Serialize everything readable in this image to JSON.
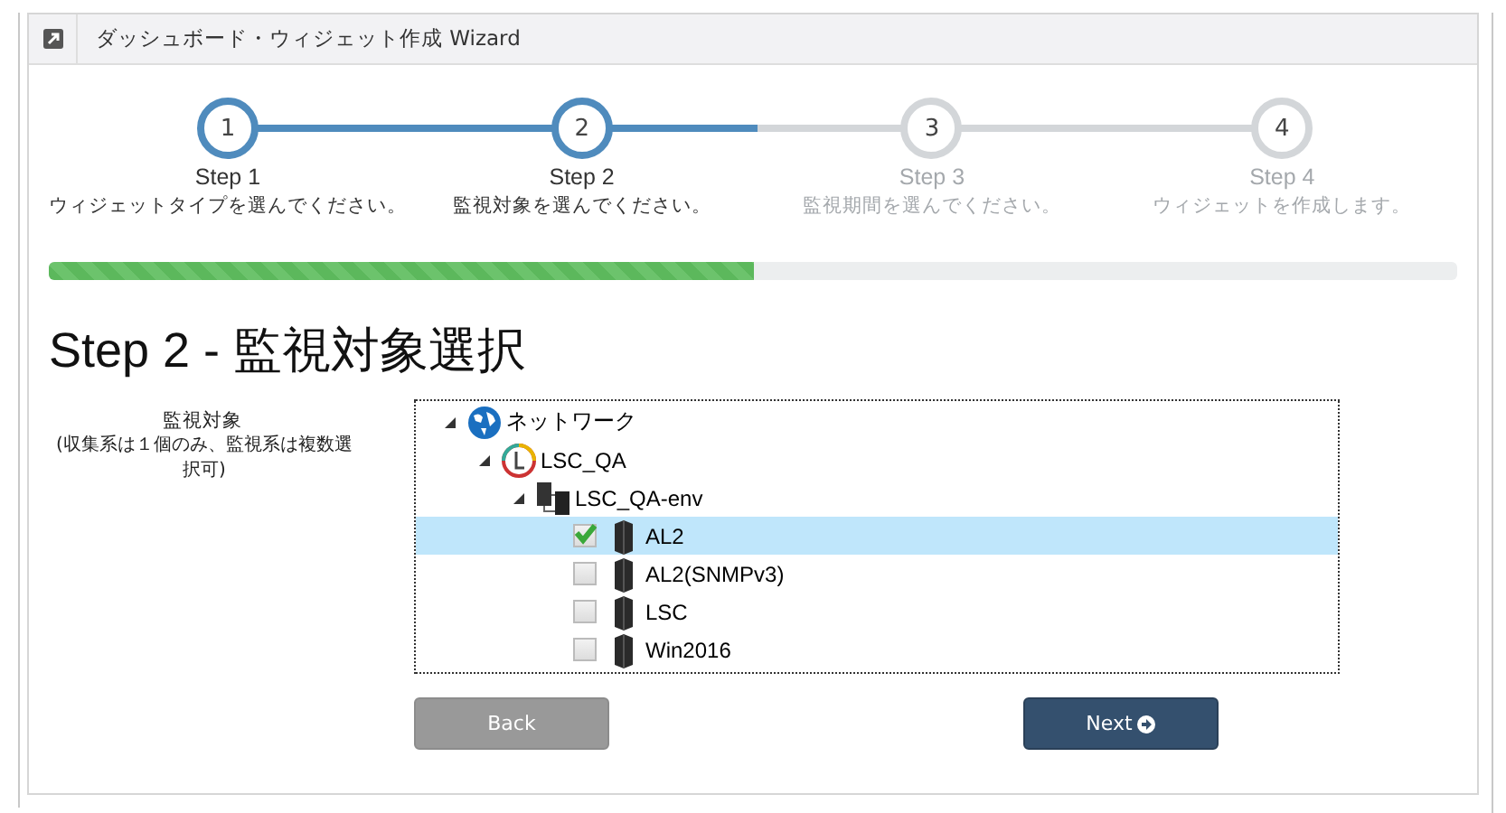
{
  "window": {
    "title": "ダッシュボード・ウィジェット作成 Wizard"
  },
  "steps": [
    {
      "number": "1",
      "label": "Step 1",
      "description": "ウィジェットタイプを選んでください。",
      "active": true
    },
    {
      "number": "2",
      "label": "Step 2",
      "description": "監視対象を選んでください。",
      "active": true
    },
    {
      "number": "3",
      "label": "Step 3",
      "description": "監視期間を選んでください。",
      "active": false
    },
    {
      "number": "4",
      "label": "Step 4",
      "description": "ウィジェットを作成します。",
      "active": false
    }
  ],
  "progress": {
    "level": 0.5
  },
  "heading": "Step 2 - 監視対象選択",
  "field_label": {
    "title": "監視対象",
    "note": "(収集系は１個のみ、監視系は複数選択可)"
  },
  "tree": [
    {
      "label": "ネットワーク",
      "kind": "network",
      "expanded": true,
      "children": [
        {
          "label": "LSC_QA",
          "kind": "group",
          "expanded": true,
          "children": [
            {
              "label": "LSC_QA-env",
              "kind": "env",
              "expanded": true,
              "children": [
                {
                  "label": "AL2",
                  "kind": "server",
                  "checked": true,
                  "selected": true
                },
                {
                  "label": "AL2(SNMPv3)",
                  "kind": "server",
                  "checked": false,
                  "selected": false
                },
                {
                  "label": "LSC",
                  "kind": "server",
                  "checked": false,
                  "selected": false
                },
                {
                  "label": "Win2016",
                  "kind": "server",
                  "checked": false,
                  "selected": false
                }
              ]
            }
          ]
        }
      ]
    }
  ],
  "buttons": [
    {
      "label": "Back",
      "kind": "back"
    },
    {
      "label": "Next",
      "kind": "next"
    }
  ]
}
